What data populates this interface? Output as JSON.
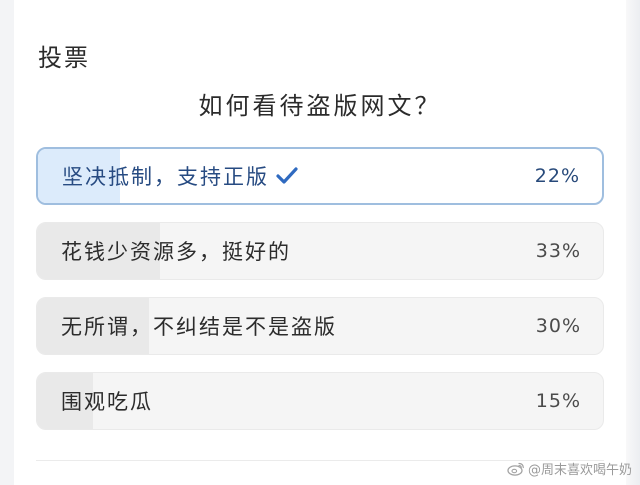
{
  "poll": {
    "title": "投票",
    "question": "如何看待盗版网文？",
    "options": [
      {
        "label": "坚决抵制，支持正版",
        "percent_label": "22%",
        "percent": 22,
        "selected": true
      },
      {
        "label": "花钱少资源多，挺好的",
        "percent_label": "33%",
        "percent": 33,
        "selected": false
      },
      {
        "label": "无所谓，不纠结是不是盗版",
        "percent_label": "30%",
        "percent": 30,
        "selected": false
      },
      {
        "label": "围观吃瓜",
        "percent_label": "15%",
        "percent": 15,
        "selected": false
      }
    ]
  },
  "watermark": {
    "text": "@周末喜欢喝午奶",
    "icon": "weibo-icon"
  },
  "colors": {
    "selected_fill": "#dcebfb",
    "selected_border": "#9fbedf",
    "check": "#2f6ac0",
    "unselected_fill": "#e9e9e9",
    "track": "#f5f5f5"
  }
}
